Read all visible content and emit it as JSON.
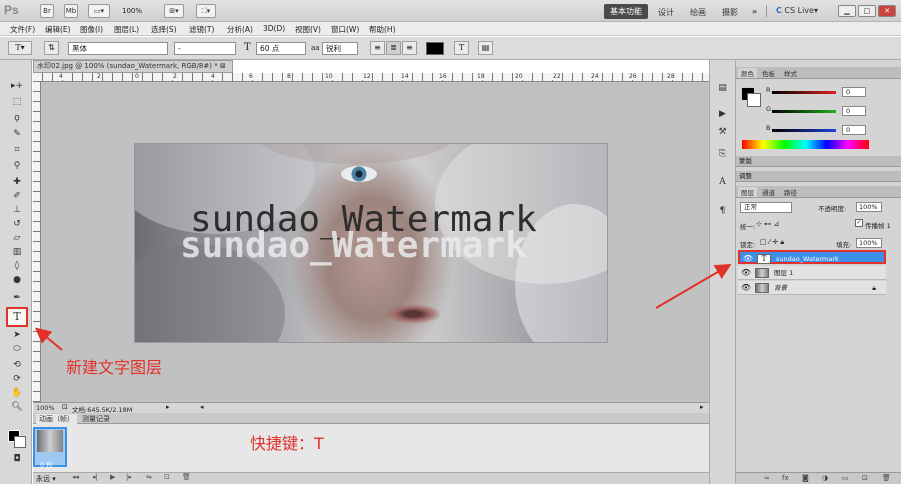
{
  "app": {
    "logo": "Ps",
    "bridge_label": "Br",
    "mini_bridge_label": "Mb",
    "zoom_dropdown": "100%",
    "workspaces": [
      "基本功能",
      "设计",
      "绘画",
      "摄影"
    ],
    "more_label": "»",
    "cs_live": "CS Live"
  },
  "menu": [
    "文件(F)",
    "编辑(E)",
    "图像(I)",
    "图层(L)",
    "选择(S)",
    "滤镜(T)",
    "分析(A)",
    "3D(D)",
    "视图(V)",
    "窗口(W)",
    "帮助(H)"
  ],
  "options_bar": {
    "tool_glyph": "T",
    "font_family": "黑体",
    "font_style": "-",
    "font_size": "60 点",
    "antialias_prefix": "aa",
    "antialias": "锐利",
    "warp_icon": "T"
  },
  "document": {
    "tab_title": "水印02.jpg @ 100% (sundao_Watermark, RGB/8#) *",
    "ruler_numbers": [
      "4",
      "2",
      "0",
      "2",
      "4",
      "6",
      "8",
      "10",
      "12",
      "14",
      "16",
      "18",
      "20",
      "22",
      "24",
      "26",
      "28"
    ],
    "watermark_dark": "sundao_Watermark",
    "watermark_light": "sundao_Watermark",
    "zoom": "100%",
    "doc_size": "文档:645.5K/2.18M"
  },
  "animation": {
    "tabs": [
      "动画（帧）",
      "测量记录"
    ],
    "frame_time": "0 秒",
    "loop": "永远"
  },
  "panels": {
    "color_tabs": [
      "颜色",
      "色板",
      "样式"
    ],
    "color_channels": [
      {
        "label": "R",
        "value": "0",
        "color": "#e02020"
      },
      {
        "label": "G",
        "value": "0",
        "color": "#20b020"
      },
      {
        "label": "B",
        "value": "0",
        "color": "#2040e0"
      }
    ],
    "collapsed_panel_1": "蒙版",
    "collapsed_panel_2": "调整",
    "layer_tabs": [
      "图层",
      "通道",
      "路径"
    ],
    "blend_mode": "正常",
    "opacity_label": "不透明度:",
    "opacity": "100%",
    "unify_label": "统一:",
    "propagate_label": "传播帧 1",
    "lock_label": "锁定:",
    "fill_label": "填充:",
    "fill": "100%",
    "layers": [
      {
        "name": "sundao_Watermark",
        "thumb": "T",
        "selected": true
      },
      {
        "name": "图层 1",
        "thumb": "",
        "selected": false
      },
      {
        "name": "背景",
        "thumb": "",
        "selected": false
      }
    ]
  },
  "annotations": {
    "new_text_layer": "新建文字图层",
    "shortcut": "快捷键：T",
    "color": "#e0312a"
  }
}
